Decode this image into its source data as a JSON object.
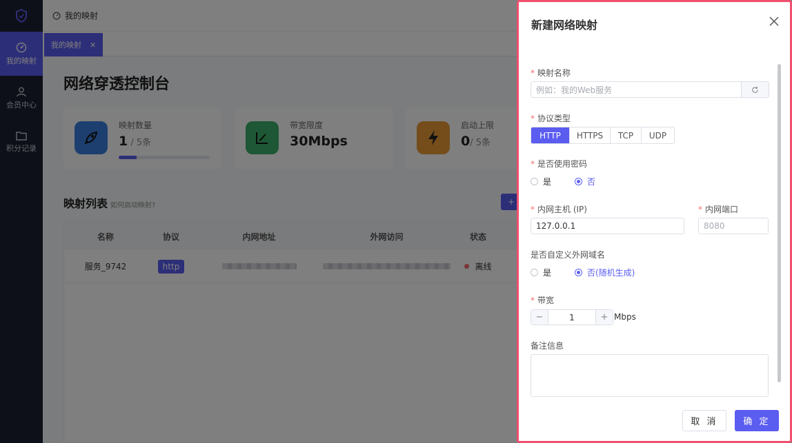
{
  "sidebar": {
    "items": [
      {
        "label": "我的映射",
        "icon": "gauge-icon"
      },
      {
        "label": "会员中心",
        "icon": "user-icon"
      },
      {
        "label": "积分记录",
        "icon": "folder-icon"
      }
    ]
  },
  "header": {
    "breadcrumb": "我的映射"
  },
  "tabs": [
    {
      "label": "我的映射"
    }
  ],
  "page": {
    "title": "网络穿透控制台",
    "stats": [
      {
        "label": "映射数量",
        "value": "1",
        "unit": " / 5条",
        "progress": 0.2
      },
      {
        "label": "带宽限度",
        "value": "30Mbps"
      },
      {
        "label": "启动上限",
        "value": "0",
        "unit": "/ 5条"
      }
    ],
    "list_title": "映射列表",
    "list_help": "如何启动映射?",
    "add_button": "+",
    "table": {
      "columns": [
        "名称",
        "协议",
        "内网地址",
        "外网访问",
        "状态"
      ],
      "rows": [
        {
          "name": "服务_9742",
          "protocol": "http",
          "status": "离线"
        }
      ]
    }
  },
  "drawer": {
    "title": "新建网络映射",
    "name_label": "映射名称",
    "name_placeholder": "例如：我的Web服务",
    "protocol_label": "协议类型",
    "protocols": [
      "HTTP",
      "HTTPS",
      "TCP",
      "UDP"
    ],
    "protocol_selected": "HTTP",
    "password_label": "是否使用密码",
    "password_yes": "是",
    "password_no": "否",
    "host_label": "内网主机 (IP)",
    "host_value": "127.0.0.1",
    "port_label": "内网端口",
    "port_placeholder": "8080",
    "domain_label": "是否自定义外网域名",
    "domain_yes": "是",
    "domain_no": "否(随机生成)",
    "bandwidth_label": "带宽",
    "bandwidth_value": "1",
    "bandwidth_unit": "Mbps",
    "remark_label": "备注信息",
    "cancel": "取 消",
    "confirm": "确 定"
  },
  "colors": {
    "accent": "#5b5cf0",
    "sidebar": "#1d2033",
    "danger": "#f56c6c"
  }
}
